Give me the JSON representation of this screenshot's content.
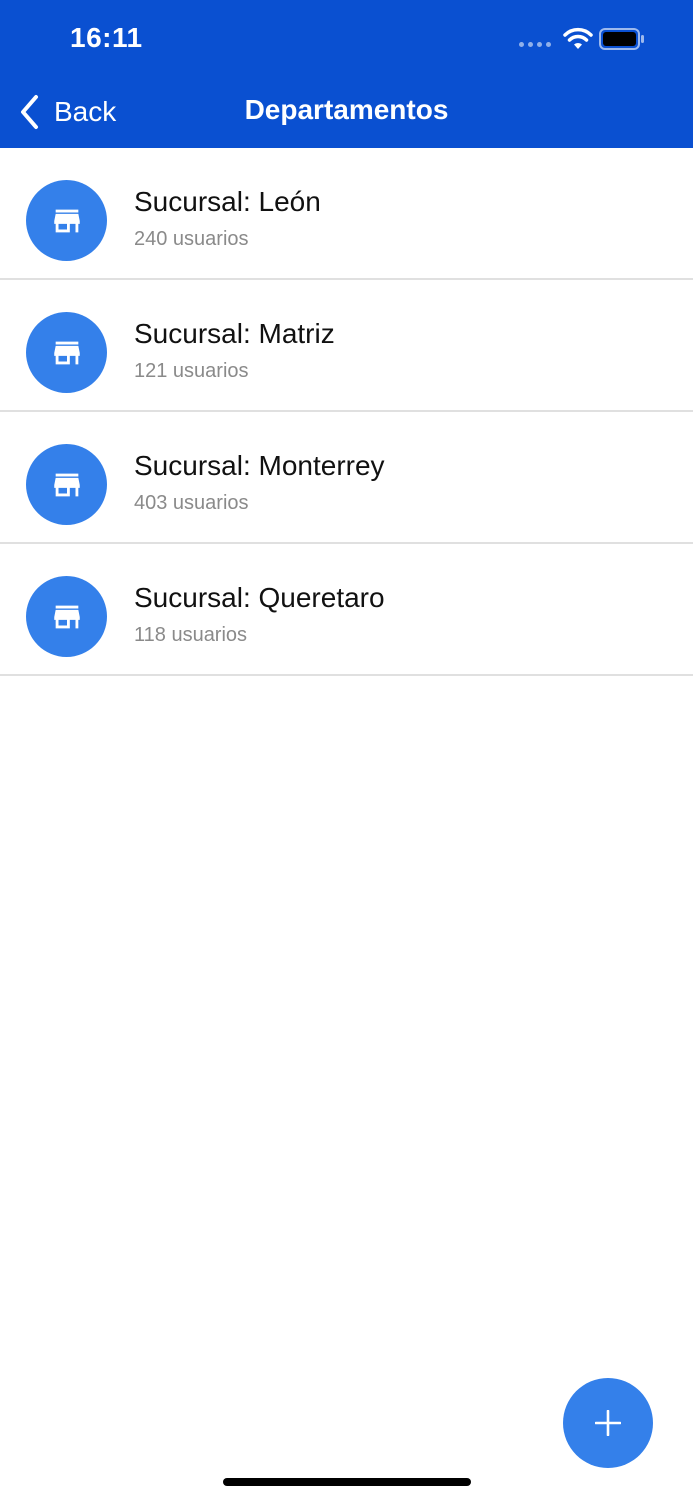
{
  "status_bar": {
    "time": "16:11",
    "icons": [
      "signal-icon",
      "wifi-icon",
      "battery-icon"
    ]
  },
  "nav": {
    "back_label": "Back",
    "title": "Departamentos"
  },
  "list": {
    "items": [
      {
        "icon": "store-icon",
        "title": "Sucursal: León",
        "subtitle": "240 usuarios"
      },
      {
        "icon": "store-icon",
        "title": "Sucursal: Matriz",
        "subtitle": "121 usuarios"
      },
      {
        "icon": "store-icon",
        "title": "Sucursal: Monterrey",
        "subtitle": "403 usuarios"
      },
      {
        "icon": "store-icon",
        "title": "Sucursal: Queretaro",
        "subtitle": "118 usuarios"
      }
    ]
  },
  "fab": {
    "icon": "plus-icon"
  },
  "colors": {
    "header_bg": "#0a50d1",
    "accent": "#3480ea",
    "subtitle": "#8a8a8a",
    "divider": "#e0e0e0"
  }
}
